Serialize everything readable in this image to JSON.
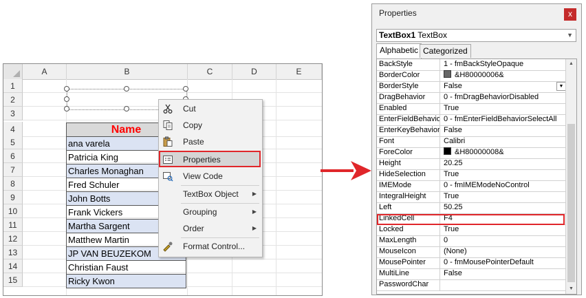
{
  "sheet": {
    "columns": [
      "A",
      "B",
      "C",
      "D",
      "E"
    ],
    "rows": [
      "1",
      "2",
      "3",
      "4",
      "5",
      "6",
      "7",
      "8",
      "9",
      "10",
      "11",
      "12",
      "13",
      "14",
      "15"
    ],
    "table_header": "Name",
    "names": [
      "ana varela",
      "Patricia King",
      "Charles Monaghan",
      "Fred Schuler",
      "John Botts",
      "Frank Vickers",
      "Martha Sargent",
      "Matthew Martin",
      "JP VAN BEUZEKOM",
      "Christian Faust",
      "Ricky Kwon"
    ]
  },
  "context_menu": {
    "items": [
      {
        "label": "Cut",
        "icon": "scissors-icon"
      },
      {
        "label": "Copy",
        "icon": "copy-icon"
      },
      {
        "label": "Paste",
        "icon": "clipboard-icon"
      },
      {
        "label": "Properties",
        "icon": "properties-icon"
      },
      {
        "label": "View Code",
        "icon": "view-code-icon"
      },
      {
        "label": "TextBox Object",
        "icon": "",
        "submenu": true
      },
      {
        "label": "Grouping",
        "icon": "",
        "submenu": true
      },
      {
        "label": "Order",
        "icon": "",
        "submenu": true
      },
      {
        "label": "Format Control...",
        "icon": "format-control-icon"
      }
    ]
  },
  "properties": {
    "title": "Properties",
    "close_label": "x",
    "object_name": "TextBox1",
    "object_type": "TextBox",
    "tabs": [
      "Alphabetic",
      "Categorized"
    ],
    "rows": [
      {
        "name": "BackStyle",
        "value": "1 - fmBackStyleOpaque"
      },
      {
        "name": "BorderColor",
        "value": "&H80000006&",
        "swatch": "#666666"
      },
      {
        "name": "BorderStyle",
        "value": "False"
      },
      {
        "name": "DragBehavior",
        "value": "0 - fmDragBehaviorDisabled"
      },
      {
        "name": "Enabled",
        "value": "True"
      },
      {
        "name": "EnterFieldBehavior",
        "value": "0 - fmEnterFieldBehaviorSelectAll"
      },
      {
        "name": "EnterKeyBehavior",
        "value": "False"
      },
      {
        "name": "Font",
        "value": "Calibri"
      },
      {
        "name": "ForeColor",
        "value": "&H80000008&",
        "swatch": "#000000"
      },
      {
        "name": "Height",
        "value": "20.25"
      },
      {
        "name": "HideSelection",
        "value": "True"
      },
      {
        "name": "IMEMode",
        "value": "0 - fmIMEModeNoControl"
      },
      {
        "name": "IntegralHeight",
        "value": "True"
      },
      {
        "name": "Left",
        "value": "50.25"
      },
      {
        "name": "LinkedCell",
        "value": "F4"
      },
      {
        "name": "Locked",
        "value": "True"
      },
      {
        "name": "MaxLength",
        "value": "0"
      },
      {
        "name": "MouseIcon",
        "value": "(None)"
      },
      {
        "name": "MousePointer",
        "value": "0 - fmMousePointerDefault"
      },
      {
        "name": "MultiLine",
        "value": "False"
      },
      {
        "name": "PasswordChar",
        "value": ""
      }
    ]
  },
  "colors": {
    "highlight": "#e0262a",
    "header_text": "#ff0000",
    "row_shade": "#dbe3f3"
  }
}
